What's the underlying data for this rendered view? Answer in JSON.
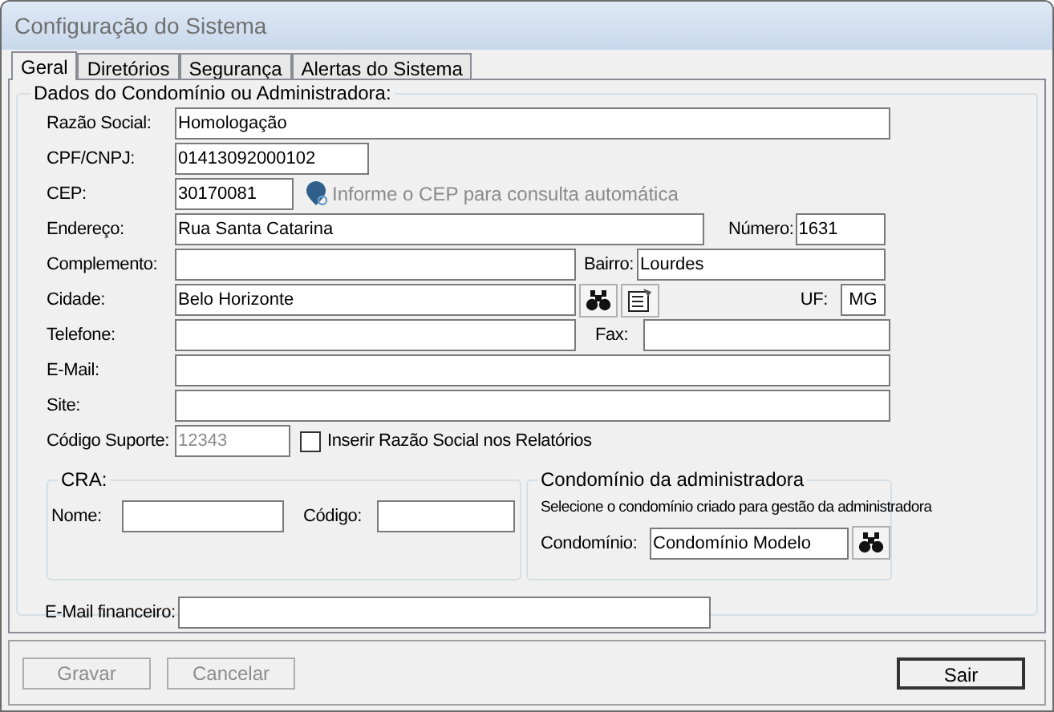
{
  "window": {
    "title": "Configuração do Sistema"
  },
  "tabs": [
    {
      "label": "Geral",
      "selected": true
    },
    {
      "label": "Diretórios",
      "selected": false
    },
    {
      "label": "Segurança",
      "selected": false
    },
    {
      "label": "Alertas do Sistema",
      "selected": false
    }
  ],
  "group": {
    "title": "Dados do Condomínio ou Administradora:"
  },
  "razao_social": {
    "label": "Razão Social:",
    "value": "Homologação"
  },
  "cpf_cnpj": {
    "label": "CPF/CNPJ:",
    "value": "01413092000102"
  },
  "cep": {
    "label": "CEP:",
    "value": "30170081",
    "hint": "Informe o CEP para consulta automática"
  },
  "endereco": {
    "label": "Endereço:",
    "value": "Rua Santa Catarina"
  },
  "numero": {
    "label": "Número:",
    "value": "1631"
  },
  "complemento": {
    "label": "Complemento:"
  },
  "bairro": {
    "label": "Bairro:",
    "value": "Lourdes"
  },
  "cidade": {
    "label": "Cidade:",
    "value": "Belo Horizonte"
  },
  "uf": {
    "label": "UF:",
    "value": "MG"
  },
  "telefone": {
    "label": "Telefone:"
  },
  "fax": {
    "label": "Fax:"
  },
  "email": {
    "label": "E-Mail:"
  },
  "site": {
    "label": "Site:"
  },
  "codigo_suporte": {
    "label": "Código Suporte:",
    "value": "12343",
    "disabled": true
  },
  "inserir_razao": {
    "label": "Inserir Razão Social nos Relatórios",
    "checked": false
  },
  "cra": {
    "title": "CRA:",
    "nome": {
      "label": "Nome:"
    },
    "codigo": {
      "label": "Código:"
    }
  },
  "condominio_adm": {
    "title": "Condomínio da administradora",
    "description": "Selecione o condomínio criado para gestão da administradora",
    "condominio": {
      "label": "Condomínio:",
      "value": "Condomínio Modelo"
    }
  },
  "email_financeiro": {
    "label": "E-Mail financeiro:"
  },
  "buttons": [
    {
      "label": "Gravar",
      "disabled": true,
      "default": false
    },
    {
      "label": "Cancelar",
      "disabled": true,
      "default": false
    },
    {
      "label": "Sair",
      "disabled": false,
      "default": true
    }
  ]
}
